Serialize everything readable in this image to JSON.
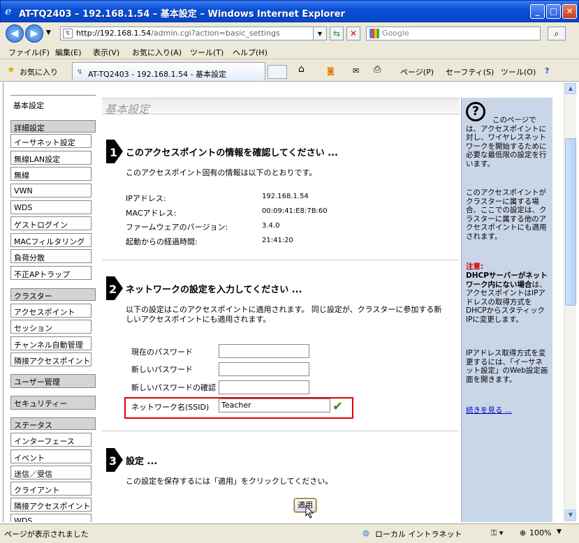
{
  "window": {
    "title": "AT-TQ2403 – 192.168.1.54 – 基本設定 – Windows Internet Explorer",
    "minimize": "_",
    "maximize": "□",
    "close": "✕"
  },
  "address": {
    "url_host": "http://192.168.1.54",
    "url_path": "/admin.cgi?action=basic_settings",
    "search_placeholder": "Google"
  },
  "menu": [
    "ファイル(F)",
    "編集(E)",
    "表示(V)",
    "お気に入り(A)",
    "ツール(T)",
    "ヘルプ(H)"
  ],
  "favbar": {
    "favorites": "お気に入り",
    "tab_title": "AT-TQ2403 - 192.168.1.54 - 基本設定",
    "page": "ページ(P)",
    "safety": "セーフティ(S)",
    "tools": "ツール(O)"
  },
  "sidebar": {
    "basic": "基本設定",
    "advanced": "詳細設定",
    "advanced_items": [
      "イーサネット設定",
      "無線LAN設定",
      "無線",
      "VWN",
      "WDS",
      "ゲストログイン",
      "MACフィルタリング",
      "負荷分散",
      "不正APトラップ"
    ],
    "cluster": "クラスター",
    "cluster_items": [
      "アクセスポイント",
      "セッション",
      "チャンネル自動管理",
      "隣接アクセスポイント"
    ],
    "user_mgmt": "ユーザー管理",
    "security": "セキュリティー",
    "status": "ステータス",
    "status_items": [
      "インターフェース",
      "イベント",
      "送信／受信",
      "クライアント",
      "隣接アクセスポイント",
      "WDS"
    ]
  },
  "main": {
    "page_title": "基本設定",
    "s1": {
      "heading": "このアクセスポイントの情報を確認してください ...",
      "intro": "このアクセスポイント固有の情報は以下のとおりです。",
      "rows": [
        {
          "label": "IPアドレス:",
          "value": "192.168.1.54"
        },
        {
          "label": "MACアドレス:",
          "value": "00:09:41:E8:7B:60"
        },
        {
          "label": "ファームウェアのバージョン:",
          "value": "3.4.0"
        },
        {
          "label": "起動からの経過時間:",
          "value": "21:41:20"
        }
      ]
    },
    "s2": {
      "heading": "ネットワークの設定を入力してください ...",
      "intro1": "以下の設定はこのアクセスポイントに適用されます。 同じ設定が、クラスターに参加する新",
      "intro2": "しいアクセスポイントにも適用されます。",
      "current_pw": "現在のパスワード",
      "new_pw": "新しいパスワード",
      "confirm_pw": "新しいパスワードの確認",
      "ssid_label": "ネットワーク名(SSID)",
      "ssid_value": "Teacher",
      "check": "✔"
    },
    "s3": {
      "heading": "設定 ...",
      "intro": "この設定を保存するには「適用」をクリックしてください。",
      "apply": "適用"
    }
  },
  "help": {
    "p1": "このページでは、アクセスポイントに対し、ワイヤレスネットワークを開始するために必要な最低限の設定を行います。",
    "p2": "このアクセスポイントがクラスターに属する場合、ここでの設定は、クラスターに属する他のアクセスポイントにも適用されます。",
    "warn_label": "注意:",
    "p3_bold": "DHCPサーバーがネットワーク内にない場合",
    "p3": "は、アクセスポイントはIPアドレスの取得方式をDHCPからスタティックIPに変更します。",
    "p4": "IPアドレス取得方式を変更するには、「イーサネット設定」のWeb設定画面を開きます。",
    "more": "続きを見る ..."
  },
  "status": {
    "text": "ページが表示されました",
    "zone": "ローカル イントラネット",
    "zoom": "100%"
  }
}
